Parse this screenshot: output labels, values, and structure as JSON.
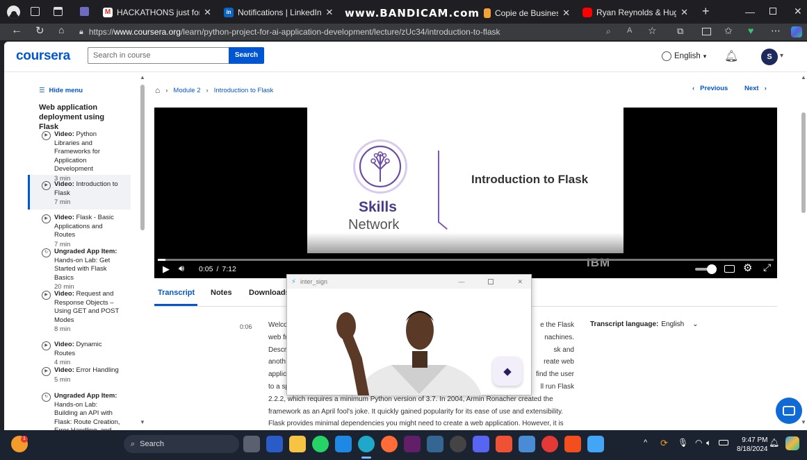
{
  "browser": {
    "tabs": [
      {
        "label": "HACKATHONS just for you, Sel",
        "favicon": "gmail"
      },
      {
        "label": "Notifications | LinkedIn",
        "favicon": "linkedin"
      },
      {
        "label": "www.BANDICAM.com",
        "favicon": "bandicam"
      },
      {
        "label": "Copie de Business Model - Pré",
        "favicon": "copy"
      },
      {
        "label": "Ryan Reynolds & Hugh Jackma",
        "favicon": "youtube"
      }
    ],
    "url_prefix": "https://",
    "url_domain": "www.coursera.org",
    "url_path": "/learn/python-project-for-ai-application-development/lecture/zUc34/introduction-to-flask"
  },
  "header": {
    "logo": "coursera",
    "search_placeholder": "Search in course",
    "search_button": "Search",
    "language": "English",
    "avatar_letter": "S"
  },
  "sidebar": {
    "hide_menu": "Hide menu",
    "module_title": "Web application deployment using Flask",
    "items": [
      {
        "kind": "Video:",
        "title": "Python Libraries and Frameworks for Application Development",
        "duration": "3 min",
        "active": false
      },
      {
        "kind": "Video:",
        "title": "Introduction to Flask",
        "duration": "7 min",
        "active": true
      },
      {
        "kind": "Video:",
        "title": "Flask - Basic Applications and Routes",
        "duration": "7 min",
        "active": false
      },
      {
        "kind": "Ungraded App Item:",
        "title": "Hands-on Lab: Get Started with Flask Basics",
        "duration": "20 min",
        "active": false
      },
      {
        "kind": "Video:",
        "title": "Request and Response Objects – Using GET and POST Modes",
        "duration": "8 min",
        "active": false
      },
      {
        "kind": "Video:",
        "title": "Dynamic Routes",
        "duration": "4 min",
        "active": false
      },
      {
        "kind": "Video:",
        "title": "Error Handling",
        "duration": "5 min",
        "active": false
      },
      {
        "kind": "Ungraded App Item:",
        "title": "Hands-on Lab: Building an API with Flask: Route Creation, Error Handling, and HTTP",
        "duration": "",
        "active": false
      }
    ]
  },
  "breadcrumb": {
    "module": "Module 2",
    "current": "Introduction to Flask"
  },
  "nav": {
    "previous": "Previous",
    "next": "Next"
  },
  "video": {
    "slide_brand_top": "Skills",
    "slide_brand_bottom": "Network",
    "slide_title": "Introduction to Flask",
    "watermark": "IBM",
    "current_time": "0:05",
    "separator": "/",
    "duration": "7:12",
    "progress": 0.012
  },
  "content_tabs": [
    "Transcript",
    "Notes",
    "Downloads"
  ],
  "transcript": {
    "timestamp": "0:06",
    "language_label": "Transcript language:",
    "language": "English",
    "lines": [
      {
        "left": "Welco",
        "right": "e the Flask"
      },
      {
        "left": "web fr",
        "right": "nachines."
      },
      {
        "left": "Descr",
        "right": "sk and"
      },
      {
        "left": "anoth",
        "right": "reate web"
      },
      {
        "left": "applic",
        "right": "find the user"
      },
      {
        "left": "to a sp",
        "right": "ll run Flask"
      }
    ],
    "full_lines": [
      "2.2.2, which requires a minimum Python version of 3.7. In 2004, Armin Ronacher created the",
      "framework as an April fool's joke. It quickly gained popularity for its ease of use and extensibility.",
      "Flask provides minimal dependencies you might need to create a web application. However, it is"
    ]
  },
  "overlay": {
    "title": "inter_sign"
  },
  "taskbar": {
    "search": "Search",
    "time": "9:47 PM",
    "date": "8/18/2024",
    "badge": "1"
  },
  "colors": {
    "coursera_blue": "#0056d2",
    "active_border": "#0056d2",
    "taskbar": "#1c2330"
  }
}
